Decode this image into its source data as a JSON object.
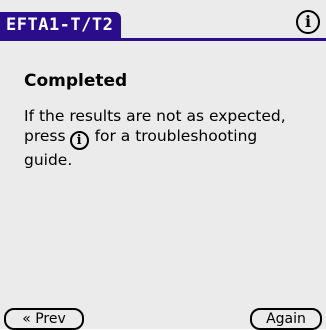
{
  "app": {
    "title": "EFTA1-T/T2",
    "info_glyph": "i",
    "accent_color": "#2a0d8a",
    "background_color": "#ebebeb"
  },
  "content": {
    "heading": "Completed",
    "message_line1": "If the results are not as expected,",
    "message_line2_before": "press",
    "message_line2_after": "for a troubleshooting",
    "message_line3": "guide.",
    "inline_icon": "info-icon"
  },
  "footer": {
    "prev_label": "« Prev",
    "again_label": "Again"
  }
}
